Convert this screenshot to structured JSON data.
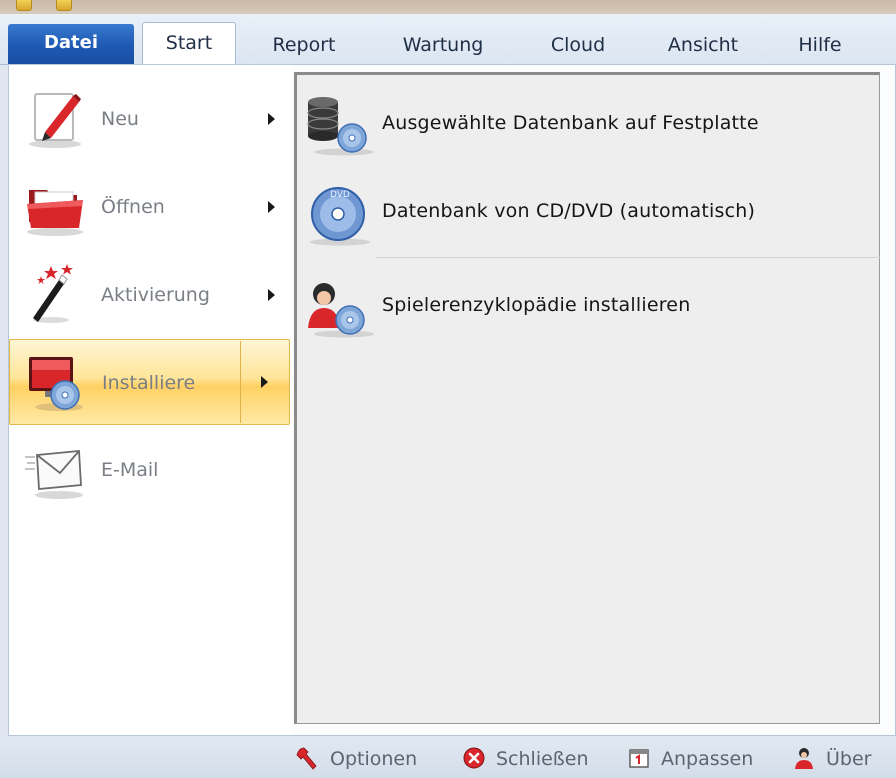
{
  "ribbon": {
    "tabs": [
      {
        "label": "Datei"
      },
      {
        "label": "Start"
      },
      {
        "label": "Report"
      },
      {
        "label": "Wartung"
      },
      {
        "label": "Cloud"
      },
      {
        "label": "Ansicht"
      },
      {
        "label": "Hilfe"
      }
    ]
  },
  "left_menu": {
    "items": [
      {
        "label": "Neu",
        "icon": "pencil-document-icon"
      },
      {
        "label": "Öffnen",
        "icon": "folder-open-icon"
      },
      {
        "label": "Aktivierung",
        "icon": "magic-wand-icon"
      },
      {
        "label": "Installiere",
        "icon": "monitor-cd-icon"
      },
      {
        "label": "E-Mail",
        "icon": "envelope-icon"
      }
    ],
    "active": "Installiere"
  },
  "submenu": {
    "items": [
      {
        "label": "Ausgewählte Datenbank auf Festplatte",
        "icon": "database-disc-icon"
      },
      {
        "label": "Datenbank von CD/DVD (automatisch)",
        "icon": "dvd-icon",
        "dvd_text": "DVD"
      },
      {
        "label": "Spielerenzyklopädie installieren",
        "icon": "player-disc-icon"
      }
    ]
  },
  "footer": {
    "buttons": [
      {
        "label": "Optionen",
        "icon": "wrench-icon"
      },
      {
        "label": "Schließen",
        "icon": "close-circle-icon"
      },
      {
        "label": "Anpassen",
        "icon": "calendar-icon"
      },
      {
        "label": "Über",
        "icon": "person-icon"
      }
    ]
  },
  "colors": {
    "datei_tab": "#1d59b3",
    "active_item": "#ffd163",
    "accent_red": "#d9262b"
  }
}
